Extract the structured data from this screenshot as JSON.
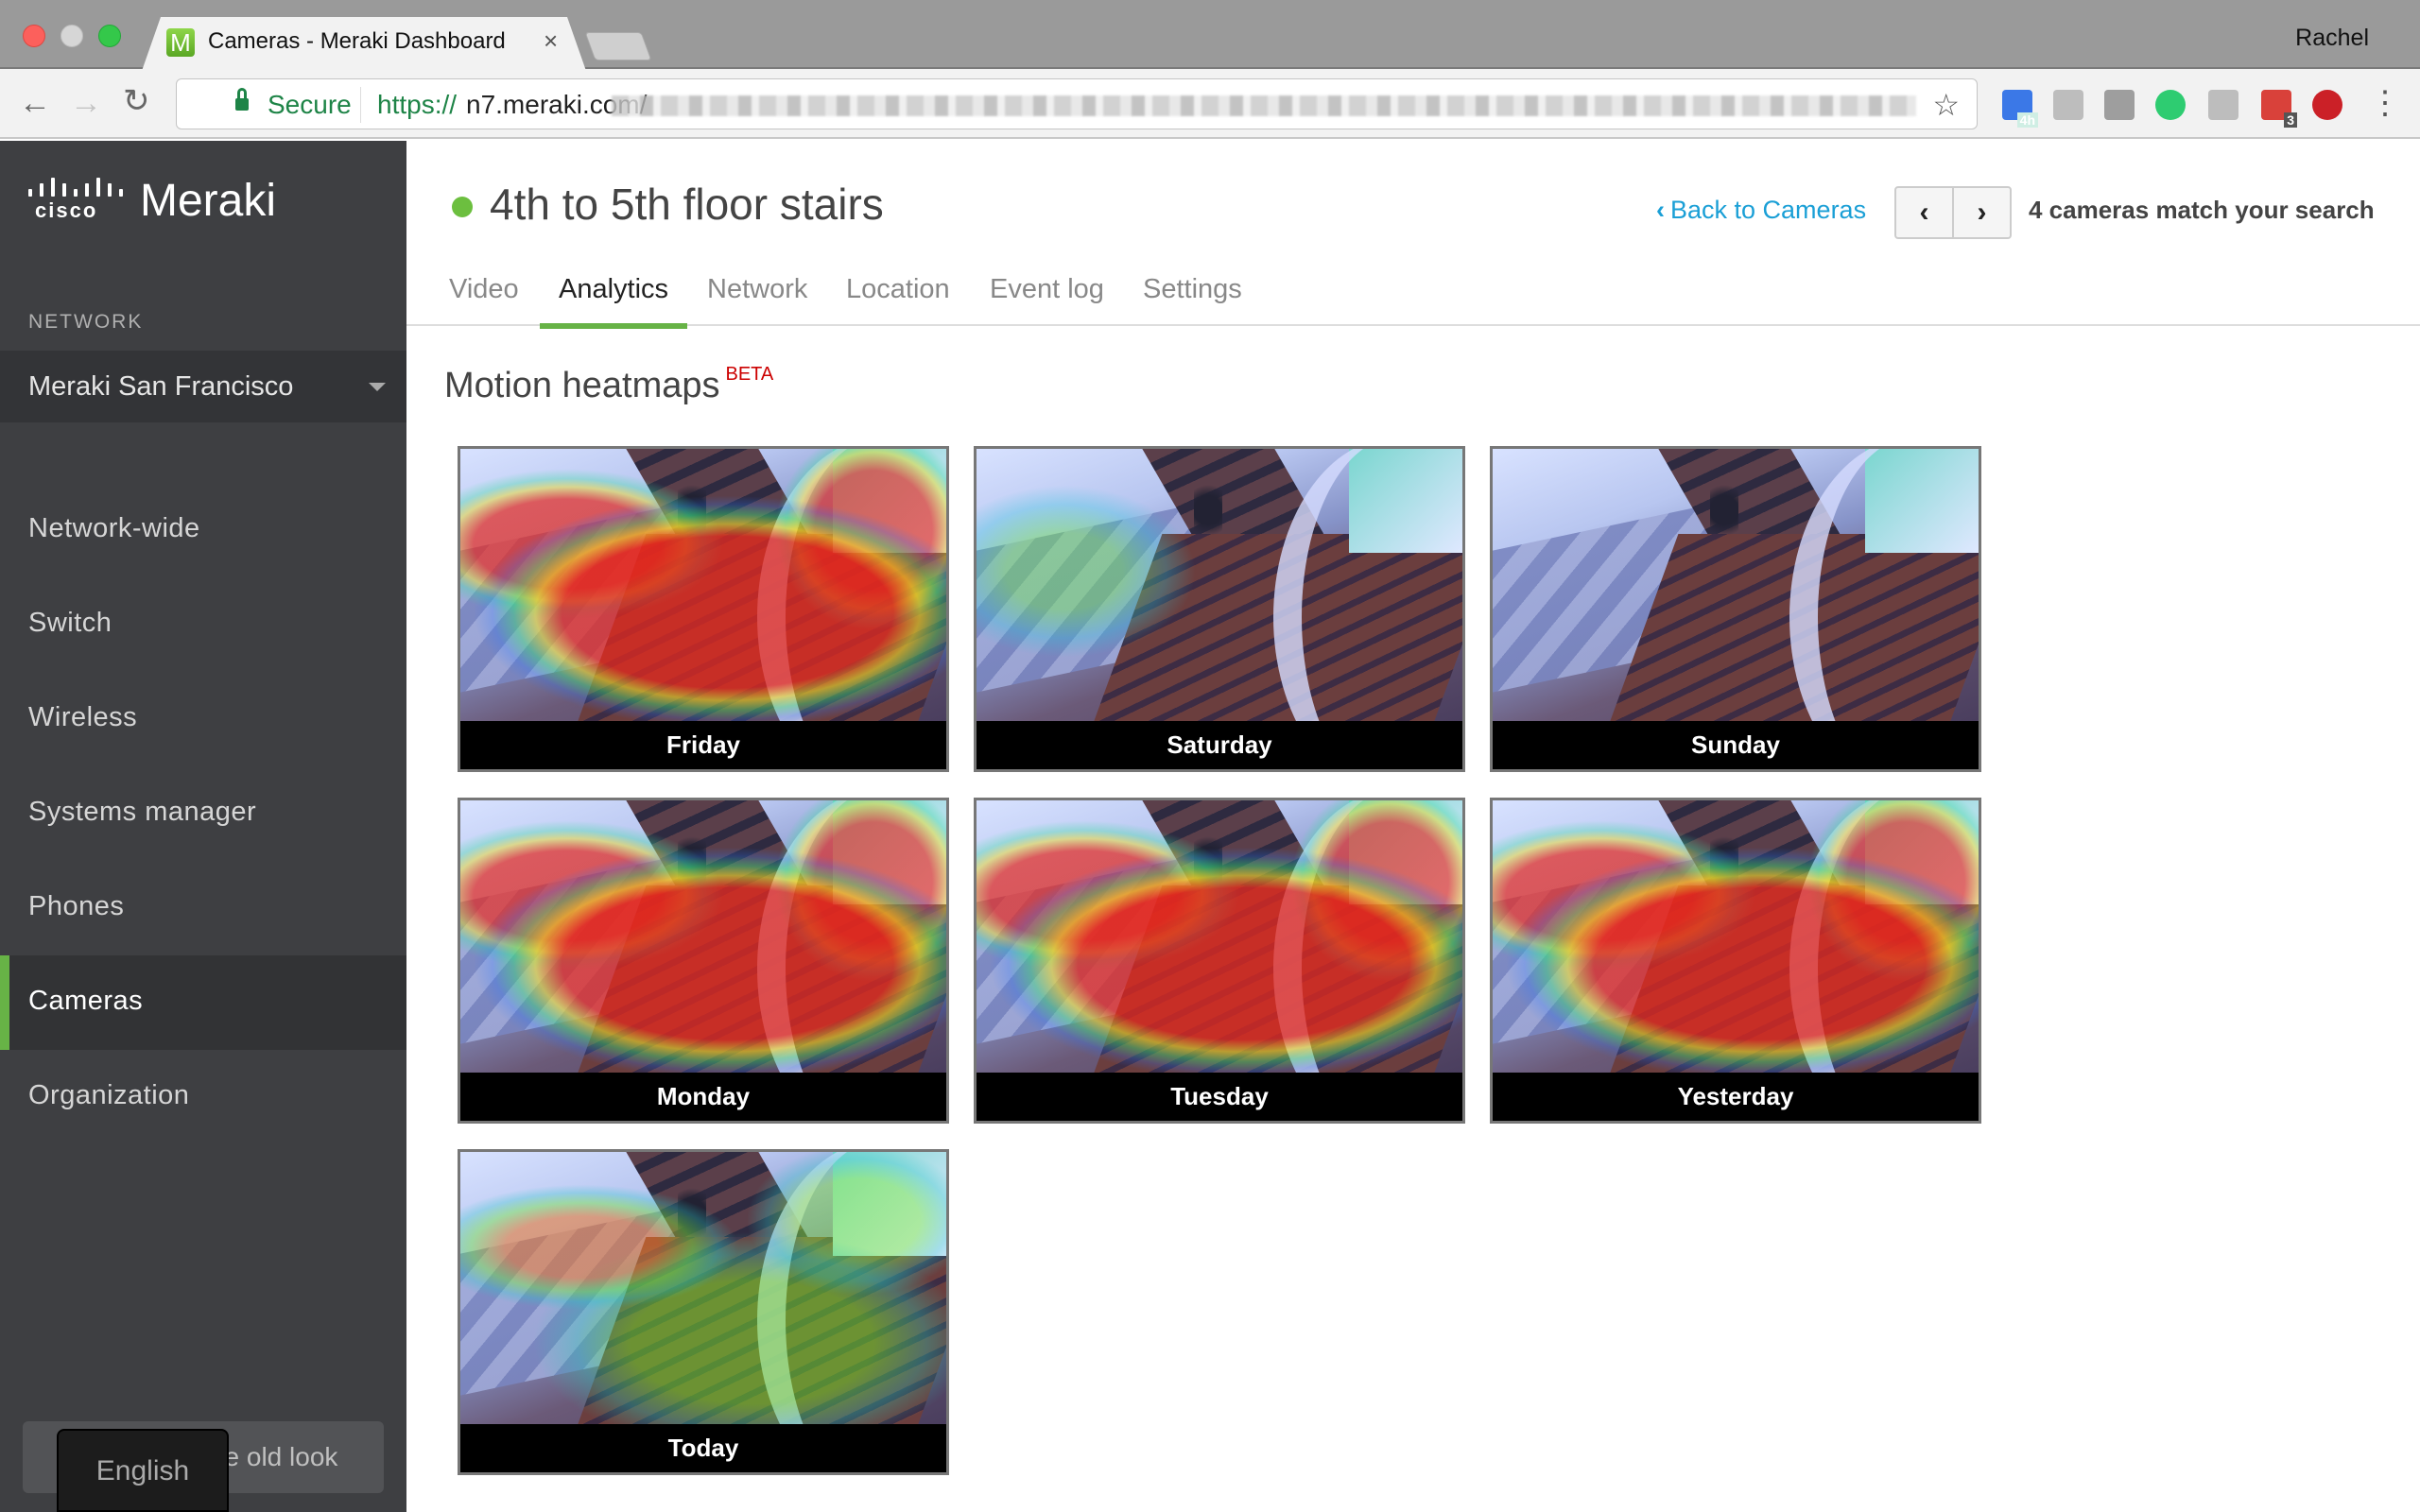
{
  "browser": {
    "tab_title": "Cameras - Meraki Dashboard",
    "tab_favicon_letter": "M",
    "tab_close_glyph": "×",
    "profile_name": "Rachel",
    "back_glyph": "←",
    "forward_glyph": "→",
    "reload_glyph": "↻",
    "secure_label": "Secure",
    "url_scheme": "https://",
    "url_host": "n7.meraki.com/",
    "url_path_obscured": true,
    "bookmark_glyph": "☆",
    "extensions": [
      {
        "name": "calendar-extension",
        "badge": "4h",
        "color": "#3b78e7"
      },
      {
        "name": "drive-extension",
        "badge": "",
        "color": "#bdbdbd"
      },
      {
        "name": "shield-extension",
        "badge": "",
        "color": "#9e9e9e"
      },
      {
        "name": "phone-extension",
        "badge": "",
        "color": "#2ecc71"
      },
      {
        "name": "honey-extension",
        "badge": "",
        "color": "#bdbdbd"
      },
      {
        "name": "lastpass-extension",
        "badge": "3",
        "color": "#d9413a"
      },
      {
        "name": "pinterest-extension",
        "badge": "",
        "color": "#cb2027"
      }
    ],
    "menu_glyph": "⋮"
  },
  "sidebar": {
    "brand_company": "cisco",
    "brand_product": "Meraki",
    "section_label": "NETWORK",
    "network_selected": "Meraki San Francisco",
    "items": [
      {
        "label": "Network-wide",
        "active": false
      },
      {
        "label": "Switch",
        "active": false
      },
      {
        "label": "Wireless",
        "active": false
      },
      {
        "label": "Systems manager",
        "active": false
      },
      {
        "label": "Phones",
        "active": false
      },
      {
        "label": "Cameras",
        "active": true
      },
      {
        "label": "Organization",
        "active": false
      }
    ],
    "old_look_label": "Go back to the old look",
    "language_popup_label": "English"
  },
  "header": {
    "camera_status": "online",
    "status_color": "#6cbf3f",
    "title": "4th to 5th floor stairs",
    "back_link": "Back to Cameras",
    "back_glyph": "‹",
    "prev_glyph": "‹",
    "next_glyph": "›",
    "match_count": "4 cameras match your search"
  },
  "tabs": [
    {
      "label": "Video",
      "active": false
    },
    {
      "label": "Analytics",
      "active": true
    },
    {
      "label": "Network",
      "active": false
    },
    {
      "label": "Location",
      "active": false
    },
    {
      "label": "Event log",
      "active": false
    },
    {
      "label": "Settings",
      "active": false
    }
  ],
  "section": {
    "title": "Motion heatmaps",
    "badge": "BETA"
  },
  "heatmaps": [
    {
      "label": "Friday",
      "intensity": "high"
    },
    {
      "label": "Saturday",
      "intensity": "low"
    },
    {
      "label": "Sunday",
      "intensity": "none"
    },
    {
      "label": "Monday",
      "intensity": "high"
    },
    {
      "label": "Tuesday",
      "intensity": "high"
    },
    {
      "label": "Yesterday",
      "intensity": "high"
    },
    {
      "label": "Today",
      "intensity": "medium"
    }
  ],
  "colors": {
    "accent_green": "#67b346",
    "link_blue": "#1a9fd6",
    "beta_red": "#cc0000",
    "sidebar_bg": "#3e3f42"
  }
}
